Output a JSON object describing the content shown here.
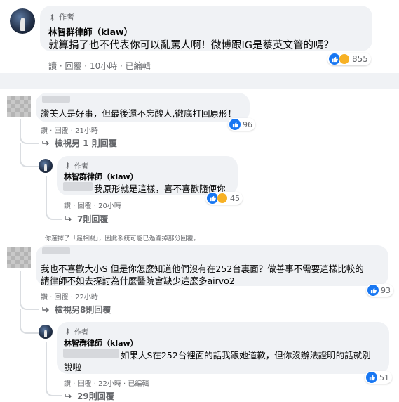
{
  "comments": [
    {
      "author_badge": "作者",
      "name": "林智群律師（klaw）",
      "text": "就算捐了也不代表你可以亂罵人啊！微博跟IG是蔡英文管的嗎？",
      "actions": [
        "讀",
        "回覆",
        "10小時",
        "已編輯"
      ],
      "reactions": "855"
    },
    {
      "text": "讚美人是好事，但最後還不忘酸人,徹底打回原形！",
      "actions": [
        "讚",
        "回覆",
        "21小時"
      ],
      "reactions": "96",
      "more_replies": "檢視另 1 則回覆",
      "reply": {
        "author_badge": "作者",
        "name": "林智群律師（klaw）",
        "text": "我原形就是這樣，喜不喜歡隨便你",
        "actions": [
          "讚",
          "回覆",
          "20小時"
        ],
        "reactions": "45",
        "more_replies": "7則回覆"
      }
    },
    {
      "text_line1": "我也不喜歡大小S 但是你怎麼知道他們沒有在252台裏面？做善事不需要這樣比較的",
      "text_line2": "請律師不如去探討為什麼醫院會缺少這麼多airvo2",
      "actions": [
        "讚",
        "回覆",
        "22小時"
      ],
      "reactions": "93",
      "more_replies": "檢視另8則回覆",
      "reply": {
        "author_badge": "作者",
        "name": "林智群律師（klaw）",
        "text_line1": "如果大S在252台裡面的話我跟她道歉，但你沒辦法證明的話就別",
        "text_line2": "說啦",
        "actions": [
          "讚",
          "回覆",
          "22小時",
          "已編輯"
        ],
        "reactions": "51",
        "more_replies": "29則回覆"
      }
    }
  ],
  "filter_notice": "你選擇了「最相關」，因此系統可能已過濾掉部分回覆。",
  "colors": {
    "like_blue": "#1877f2",
    "haha_yellow": "#f7b125",
    "bubble_gray": "#f0f2f5",
    "meta_gray": "#65676b"
  },
  "icons": [
    "author-pin-icon",
    "like-icon",
    "haha-icon",
    "reply-arrow-icon"
  ]
}
